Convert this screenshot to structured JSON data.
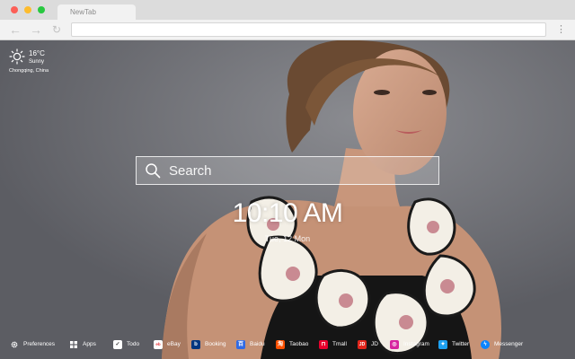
{
  "browser": {
    "tab_title": "NewTab",
    "nav": {
      "back": "←",
      "forward": "→",
      "reload": "↻",
      "menu": "⋮"
    }
  },
  "weather": {
    "temperature": "16°C",
    "condition": "Sunny",
    "location": "Chongqing,  China",
    "icon": "sun-icon"
  },
  "search": {
    "placeholder": "Search",
    "icon": "search-icon"
  },
  "clock": {
    "time": "10:10 AM",
    "date": "Tue, 12 Mon"
  },
  "bottom_bar": {
    "items": [
      {
        "label": "Preferences",
        "icon": "gear-icon"
      },
      {
        "label": "Apps",
        "icon": "apps-grid-icon"
      },
      {
        "label": "Todo",
        "icon": "checkbox-icon"
      },
      {
        "label": "eBay",
        "icon": "ebay-icon"
      },
      {
        "label": "Booking",
        "icon": "booking-icon"
      },
      {
        "label": "Baidu",
        "icon": "baidu-icon"
      },
      {
        "label": "Taobao",
        "icon": "taobao-icon"
      },
      {
        "label": "Tmall",
        "icon": "tmall-icon"
      },
      {
        "label": "JD",
        "icon": "jd-icon"
      },
      {
        "label": "Instagram",
        "icon": "instagram-icon"
      },
      {
        "label": "Twitter",
        "icon": "twitter-icon"
      },
      {
        "label": "Messenger",
        "icon": "messenger-icon"
      }
    ]
  },
  "colors": {
    "booking": "#003580",
    "baidu": "#2f6ae5",
    "taobao": "#ff5000",
    "tmall": "#e8002d",
    "jd": "#e1251b",
    "instagram": "#d6249f",
    "twitter": "#1da1f2",
    "messenger": "#0a84ff"
  }
}
